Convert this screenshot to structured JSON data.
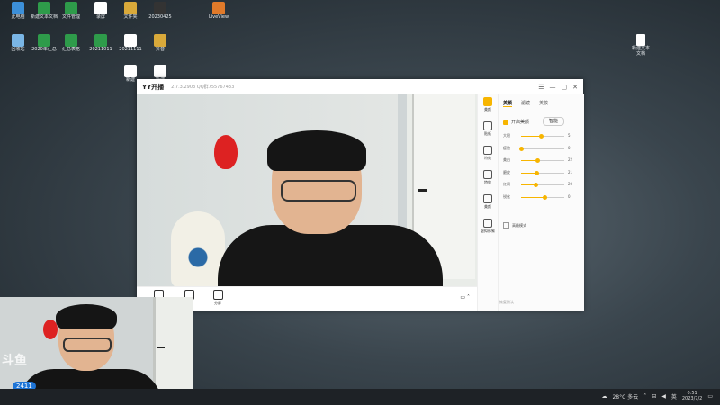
{
  "yy_window": {
    "title": "YY开播",
    "version": "2.7.3.2903 QQ群755767433",
    "controls": [
      "☰",
      "—",
      "▢",
      "✕"
    ],
    "sidebar_icons": [
      {
        "label": "美颜",
        "active": true
      },
      {
        "label": "贴纸"
      },
      {
        "label": "特效"
      },
      {
        "label": "特效"
      },
      {
        "label": "美颜"
      },
      {
        "label": "虚拟形象"
      }
    ],
    "tabs": [
      "美颜",
      "滤镜",
      "美妆"
    ],
    "beauty_toggle_label": "开启美颜",
    "beauty_mode": "智能",
    "sliders": [
      {
        "label": "大眼",
        "value": "5"
      },
      {
        "label": "瘦脸",
        "value": "0"
      },
      {
        "label": "美白",
        "value": "22"
      },
      {
        "label": "磨皮",
        "value": "21"
      },
      {
        "label": "红润",
        "value": "20"
      },
      {
        "label": "锐化",
        "value": "0"
      }
    ],
    "checkbox_label": "高级模式",
    "footer": "恢复默认",
    "bottom_buttons": [
      "",
      "",
      "分屏"
    ],
    "slider_levels": [
      0.45,
      0.0,
      0.38,
      0.36,
      0.33,
      0.55
    ]
  },
  "desktop_icons": [
    {
      "label": "此电脑",
      "color": "#3c8fd8"
    },
    {
      "label": "新建文本文档",
      "color": "#2e9b4a"
    },
    {
      "label": "文件管理",
      "color": "#2e9b4a"
    },
    {
      "label": "录屏",
      "color": "#ffffff"
    },
    {
      "label": "文件夹",
      "color": "#d9a93a"
    },
    {
      "label": "20230425",
      "color": "#333333"
    },
    {
      "label": "LiveView",
      "color": "#e07a2a"
    },
    {
      "label": "回收站",
      "color": "#7ab6e6"
    },
    {
      "label": "2020年汇总",
      "color": "#2e9b4a"
    },
    {
      "label": "汇总表格",
      "color": "#2e9b4a"
    },
    {
      "label": "20211011",
      "color": "#2e9b4a"
    },
    {
      "label": "20211111",
      "color": "#ffffff"
    },
    {
      "label": "抖音",
      "color": "#d9a93a"
    },
    {
      "label": "新建",
      "color": "#ffffff"
    },
    {
      "label": "新建",
      "color": "#ffffff"
    }
  ],
  "right_file": {
    "label": "新建文本文档"
  },
  "webcam": {
    "logo": "斗鱼",
    "badge": "2411"
  },
  "taskbar": {
    "weather": "28°C 多云",
    "lang": "英",
    "time": "0:51",
    "date": "2023/7/2"
  }
}
